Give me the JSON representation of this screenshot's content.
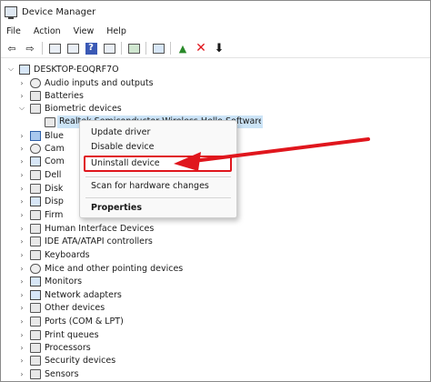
{
  "window": {
    "title": "Device Manager"
  },
  "menu": [
    "File",
    "Action",
    "View",
    "Help"
  ],
  "toolbar": {
    "buttons": [
      "back-icon",
      "forward-icon",
      "properties-icon",
      "show-hidden-icon",
      "help-icon",
      "view-icon",
      "update-driver-icon",
      "scan-hardware-icon",
      "enable-device-icon",
      "uninstall-icon",
      "download-icon"
    ],
    "colors": {
      "uninstall": "#e0161d",
      "help": "#3a59b5"
    }
  },
  "tree": {
    "root": "DESKTOP-EOQRF7O",
    "items": [
      "Audio inputs and outputs",
      "Batteries",
      "Biometric devices",
      "Realtek Semiconductor Wireless Hello Software Device",
      "Blue",
      "Cam",
      "Com",
      "Dell",
      "Disk",
      "Disp",
      "Firm",
      "Human Interface Devices",
      "IDE ATA/ATAPI controllers",
      "Keyboards",
      "Mice and other pointing devices",
      "Monitors",
      "Network adapters",
      "Other devices",
      "Ports (COM & LPT)",
      "Print queues",
      "Processors",
      "Security devices",
      "Sensors"
    ]
  },
  "context_menu": {
    "update": "Update driver",
    "disable": "Disable device",
    "uninstall": "Uninstall device",
    "scan": "Scan for hardware changes",
    "properties": "Properties"
  },
  "annotation": {
    "arrow_color": "#e0161d"
  }
}
